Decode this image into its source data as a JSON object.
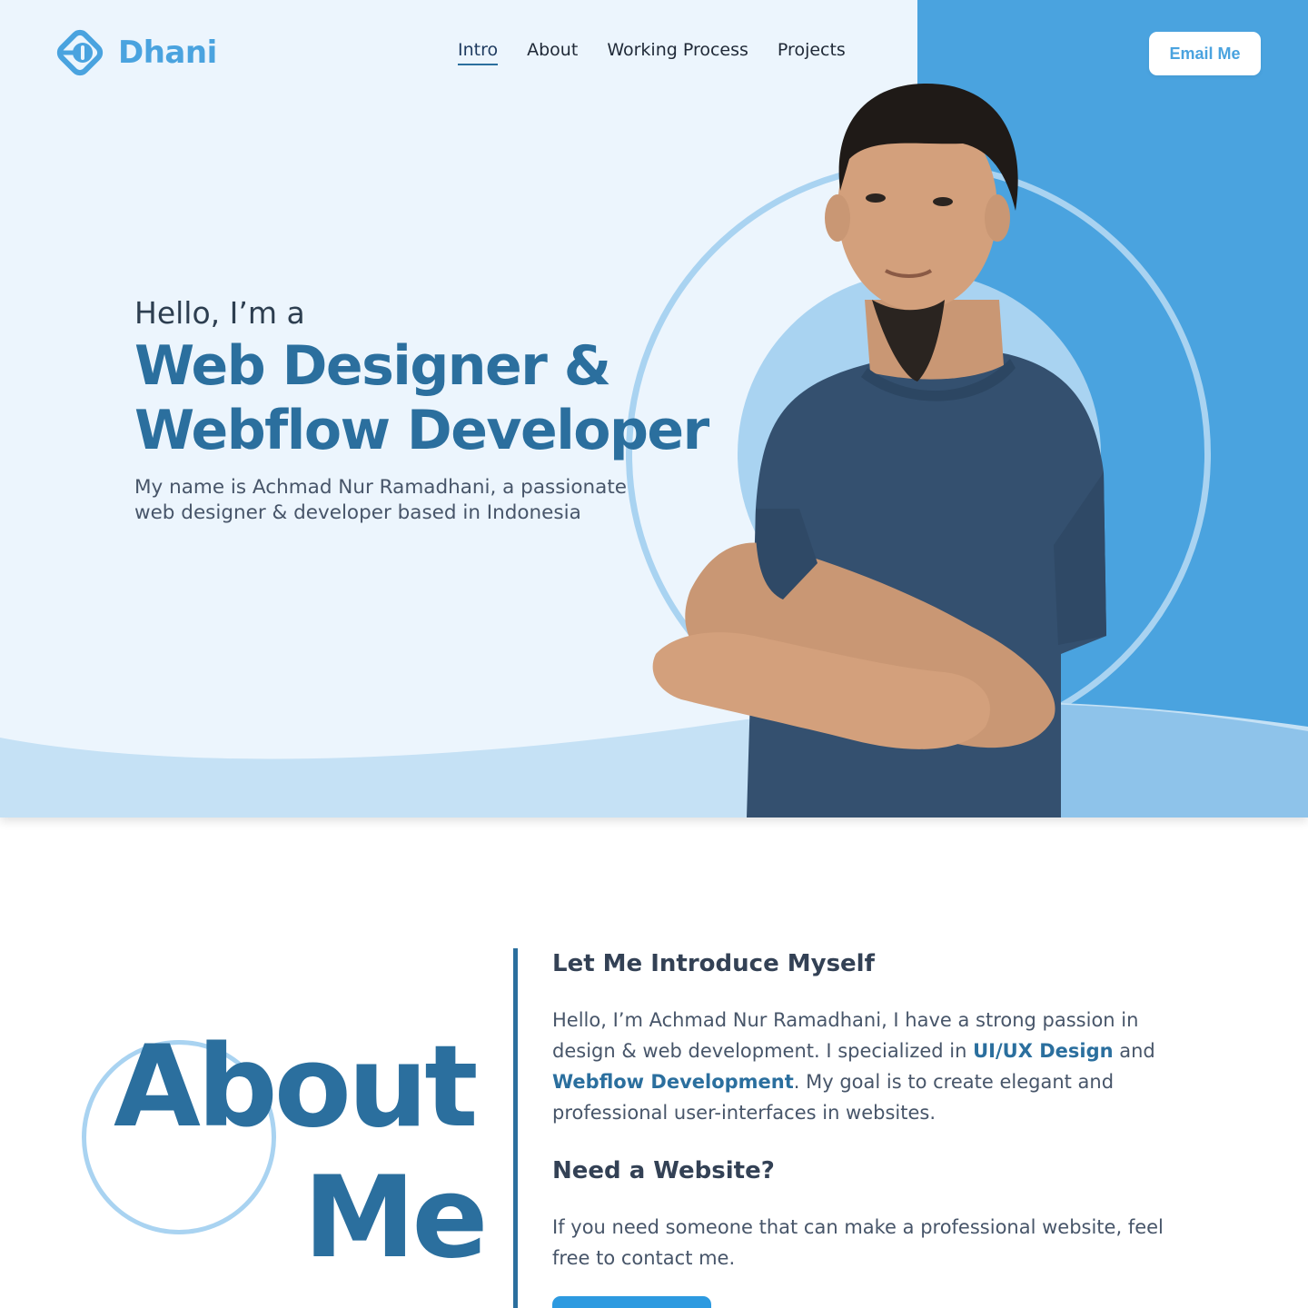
{
  "brand": {
    "name": "Dhani",
    "accent": "#4aa3df",
    "primary": "#2b6f9e",
    "logo_icon": "diamond-arrow-icon"
  },
  "nav": {
    "items": [
      {
        "label": "Intro",
        "active": true
      },
      {
        "label": "About",
        "active": false
      },
      {
        "label": "Working Process",
        "active": false
      },
      {
        "label": "Projects",
        "active": false
      }
    ],
    "cta_label": "Email Me"
  },
  "hero": {
    "greeting": "Hello, I’m a",
    "title_line1": "Web Designer &",
    "title_line2": "Webflow Developer",
    "description": "My name is Achmad Nur Ramadhani, a passionate web designer & developer based in Indonesia"
  },
  "about": {
    "big_word_1": "About",
    "big_word_2": "Me",
    "intro_heading": "Let Me Introduce Myself",
    "intro_text_part1": "Hello, I’m Achmad Nur Ramadhani, I have a strong passion in design & web development. I specialized in ",
    "intro_highlight1": "UI/UX Design",
    "intro_text_part2": " and ",
    "intro_highlight2": "Webflow Development",
    "intro_text_part3": ". My goal is to create elegant and professional user-interfaces in websites.",
    "need_heading": "Need a Website?",
    "need_text": "If you need someone that can make a professional website, feel free to contact me."
  }
}
